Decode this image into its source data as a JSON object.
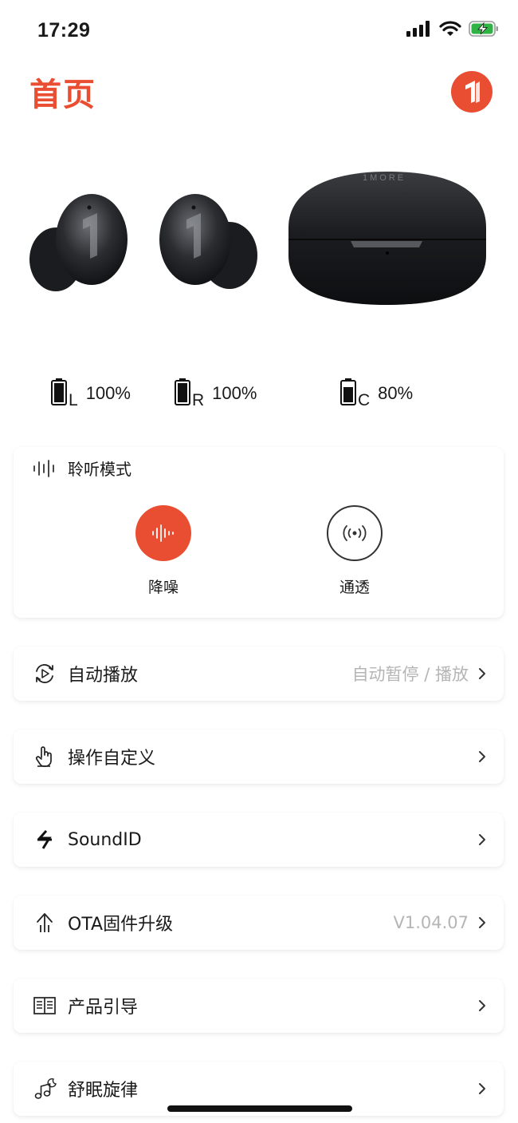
{
  "status_bar": {
    "time": "17:29"
  },
  "header": {
    "title": "首页"
  },
  "battery": [
    {
      "side": "L",
      "percent": "100%",
      "level": 1.0
    },
    {
      "side": "R",
      "percent": "100%",
      "level": 1.0
    },
    {
      "side": "C",
      "percent": "80%",
      "level": 0.8
    }
  ],
  "listening_mode": {
    "title": "聆听模式",
    "options": [
      {
        "label": "降噪",
        "active": true
      },
      {
        "label": "通透",
        "active": false
      }
    ]
  },
  "menu": [
    {
      "label": "自动播放",
      "value": "自动暂停 / 播放",
      "icon": "auto-play-icon"
    },
    {
      "label": "操作自定义",
      "value": "",
      "icon": "hand-pointer-icon"
    },
    {
      "label": "SoundID",
      "value": "",
      "icon": "soundid-icon"
    },
    {
      "label": "OTA固件升级",
      "value": "V1.04.07",
      "icon": "firmware-upgrade-icon"
    },
    {
      "label": "产品引导",
      "value": "",
      "icon": "book-icon"
    },
    {
      "label": "舒眠旋律",
      "value": "",
      "icon": "sleep-music-icon"
    }
  ],
  "colors": {
    "accent": "#ea4e32",
    "muted_text": "#b5b5b5",
    "charging": "#2fb344"
  }
}
